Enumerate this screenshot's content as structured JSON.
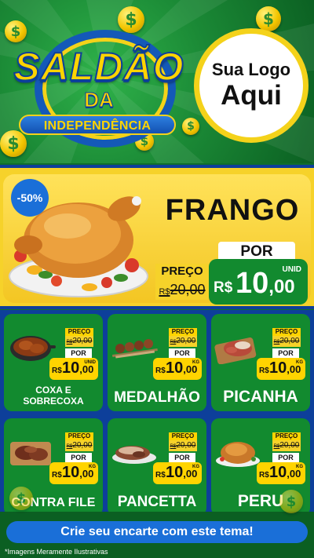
{
  "header": {
    "title_line1": "SALDÃO",
    "title_line2": "DA",
    "title_line3": "INDEPENDÊNCIA",
    "logo_line1": "Sua Logo",
    "logo_line2": "Aqui",
    "coin_icon": "dollar-coin-icon"
  },
  "featured": {
    "discount": "-50%",
    "name": "FRANGO",
    "preco_label": "PREÇO",
    "old_currency": "R$",
    "old_price": "20,00",
    "por_label": "POR",
    "currency": "R$",
    "price_main": "10",
    "price_cents": ",00",
    "unit": "UNID"
  },
  "products": [
    {
      "name_l1": "COXA E",
      "name_l2": "SOBRECOXA",
      "preco_label": "PREÇO",
      "old_currency": "R$",
      "old_price": "20,00",
      "por_label": "POR",
      "currency": "R$",
      "price_main": "10",
      "price_cents": ",00",
      "unit": "UNID"
    },
    {
      "name_l1": "MEDALHÃO",
      "preco_label": "PREÇO",
      "old_currency": "R$",
      "old_price": "20,00",
      "por_label": "POR",
      "currency": "R$",
      "price_main": "10",
      "price_cents": ",00",
      "unit": "KG"
    },
    {
      "name_l1": "PICANHA",
      "preco_label": "PREÇO",
      "old_currency": "R$",
      "old_price": "20,00",
      "por_label": "POR",
      "currency": "R$",
      "price_main": "10",
      "price_cents": ",00",
      "unit": "KG"
    },
    {
      "name_l1": "CONTRA FILE",
      "preco_label": "PREÇO",
      "old_currency": "R$",
      "old_price": "20,00",
      "por_label": "POR",
      "currency": "R$",
      "price_main": "10",
      "price_cents": ",00",
      "unit": "KG"
    },
    {
      "name_l1": "PANCETTA",
      "preco_label": "PREÇO",
      "old_currency": "R$",
      "old_price": "20,00",
      "por_label": "POR",
      "currency": "R$",
      "price_main": "10",
      "price_cents": ",00",
      "unit": "KG"
    },
    {
      "name_l1": "PERU",
      "preco_label": "PREÇO",
      "old_currency": "R$",
      "old_price": "20,00",
      "por_label": "POR",
      "currency": "R$",
      "price_main": "10",
      "price_cents": ",00",
      "unit": "KG"
    }
  ],
  "footer": {
    "cta": "Crie seu encarte com este tema!",
    "disclaimer": "*Imagens Meramente Ilustrativas"
  },
  "colors": {
    "green": "#128a2f",
    "yellow": "#f6d22a",
    "blue": "#0d3f9a",
    "accent_blue": "#1a6fd8"
  }
}
